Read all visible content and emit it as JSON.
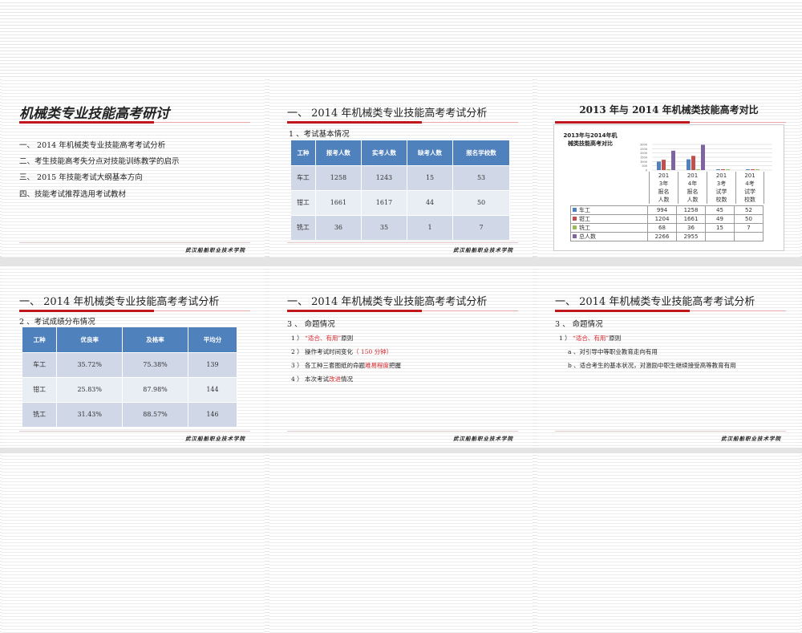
{
  "footer": "武汉船舶职业技术学院",
  "slide1": {
    "title": "机械类专业技能高考研讨",
    "items": [
      "一、 2014 年机械类专业技能高考考试分析",
      "二、考生技能高考失分点对技能训练教学的启示",
      "三、 2015 年技能考试大纲基本方向",
      "四、技能考试推荐选用考试教材"
    ]
  },
  "section_title": "一、 2014 年机械类专业技能高考考试分析",
  "slide2": {
    "subtitle": "1 、考试基本情况",
    "headers": [
      "工种",
      "报考人数",
      "实考人数",
      "缺考人数",
      "报名学校数"
    ],
    "rows": [
      [
        "车工",
        "1258",
        "1243",
        "15",
        "53"
      ],
      [
        "钳工",
        "1661",
        "1617",
        "44",
        "50"
      ],
      [
        "铣工",
        "36",
        "35",
        "1",
        "7"
      ]
    ]
  },
  "slide3": {
    "title": "2013 年与 2014 年机械类技能高考对比"
  },
  "chart_data": {
    "type": "bar",
    "title": "2013年与2014年机械类技能高考对比",
    "categories": [
      "2013年报名人数",
      "2014年报名人数",
      "2013考试学校数",
      "2014考试学校数"
    ],
    "series": [
      {
        "name": "车工",
        "color": "#4f81bd",
        "values": [
          994,
          1258,
          45,
          52
        ]
      },
      {
        "name": "钳工",
        "color": "#c0504d",
        "values": [
          1204,
          1661,
          49,
          50
        ]
      },
      {
        "name": "铣工",
        "color": "#9bbb59",
        "values": [
          68,
          36,
          15,
          7
        ]
      },
      {
        "name": "总人数",
        "color": "#8064a2",
        "values": [
          2266,
          2955,
          null,
          null
        ]
      }
    ],
    "yticks": [
      "3000",
      "2500",
      "2000",
      "1500",
      "1000",
      "500",
      "0"
    ],
    "ylim": [
      0,
      3000
    ]
  },
  "slide4": {
    "subtitle": "2 、考试成绩分布情况",
    "headers": [
      "工种",
      "优良率",
      "及格率",
      "平均分"
    ],
    "rows": [
      [
        "车工",
        "35.72%",
        "75.38%",
        "139"
      ],
      [
        "钳工",
        "25.83%",
        "87.98%",
        "144"
      ],
      [
        "铣工",
        "31.43%",
        "88.57%",
        "146"
      ]
    ]
  },
  "slide5": {
    "subtitle": "3 、 命题情况",
    "items": [
      {
        "pre": "1 ） ",
        "red": "“适合、有用”",
        "post": "原则"
      },
      {
        "pre": "2 ） 操作考试时间变化",
        "red": "（ 150 分钟）",
        "post": ""
      },
      {
        "pre": "3 ） 各工种三套图纸的命题",
        "red": "难易程度",
        "post": "把握"
      },
      {
        "pre": "4 ） 本次考试",
        "red": "改进",
        "post": "情况"
      }
    ]
  },
  "slide6": {
    "subtitle": "3 、 命题情况",
    "item1": {
      "pre": "1 ） ",
      "red": "“适合、有用”",
      "post": "原则"
    },
    "subs": [
      "a 、对引导中等职业教育走向有用",
      "b 、适合考生的基本状况，对激励中职生继续接受高等教育有用"
    ]
  }
}
